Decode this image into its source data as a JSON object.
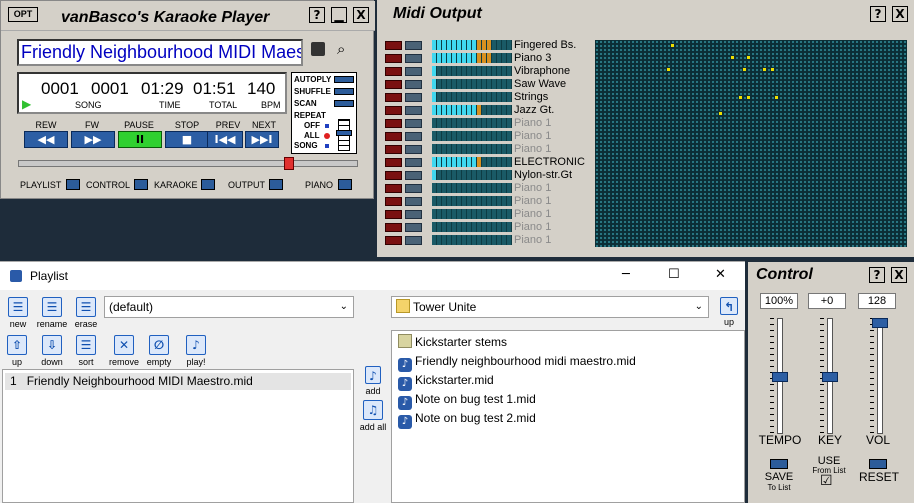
{
  "player": {
    "opt_label": "OPT",
    "title": "vanBasco's Karaoke Player",
    "help": "?",
    "minimize": "▁",
    "close": "X",
    "song_title": "Friendly Neighbourhood MIDI Maes",
    "lcd": {
      "song": "0001",
      "song_label": "SONG",
      "bar": "0001",
      "time": "01:29",
      "time_label": "TIME",
      "total": "01:51",
      "total_label": "TOTAL",
      "bpm": "140",
      "bpm_label": "BPM"
    },
    "options": {
      "autoply": "AUTOPLY",
      "shuffle": "SHUFFLE",
      "scan": "SCAN",
      "repeat": "REPEAT",
      "off": "OFF",
      "all": "ALL",
      "song": "SONG"
    },
    "transport": {
      "rew": "REW",
      "fw": "FW",
      "pause": "PAUSE",
      "stop": "STOP",
      "prev": "PREV",
      "next": "NEXT",
      "rew_glyph": "◀◀",
      "fw_glyph": "▶▶",
      "pause_glyph": "II",
      "stop_glyph": "■",
      "prev_glyph": "I◀◀",
      "next_glyph": "▶▶I"
    },
    "progress": 0.8,
    "bottom": {
      "playlist": "PLAYLIST",
      "control": "CONTROL",
      "karaoke": "KARAOKE",
      "output": "OUTPUT",
      "piano": "PIANO"
    }
  },
  "midi": {
    "title": "Midi Output",
    "help": "?",
    "close": "X",
    "channels": [
      {
        "name": "Fingered Bs.",
        "active": true,
        "level": 0.75
      },
      {
        "name": "Piano 3",
        "active": true,
        "level": 0.75
      },
      {
        "name": "Vibraphone",
        "active": true,
        "level": 0.05
      },
      {
        "name": "Saw Wave",
        "active": true,
        "level": 0.0
      },
      {
        "name": "Strings",
        "active": true,
        "level": 0.05
      },
      {
        "name": "Jazz Gt.",
        "active": true,
        "level": 0.65
      },
      {
        "name": "Piano 1",
        "active": false,
        "level": 0.0
      },
      {
        "name": "Piano 1",
        "active": false,
        "level": 0.0
      },
      {
        "name": "Piano 1",
        "active": false,
        "level": 0.0
      },
      {
        "name": "ELECTRONIC",
        "active": true,
        "level": 0.6
      },
      {
        "name": "Nylon-str.Gt",
        "active": true,
        "level": 0.0
      },
      {
        "name": "Piano 1",
        "active": false,
        "level": 0.0
      },
      {
        "name": "Piano 1",
        "active": false,
        "level": 0.0
      },
      {
        "name": "Piano 1",
        "active": false,
        "level": 0.0
      },
      {
        "name": "Piano 1",
        "active": false,
        "level": 0.0
      },
      {
        "name": "Piano 1",
        "active": false,
        "level": 0.0
      }
    ]
  },
  "playlist": {
    "title": "Playlist",
    "minimize": "─",
    "maximize": "☐",
    "close": "✕",
    "tools_top": {
      "new": "new",
      "rename": "rename",
      "erase": "erase"
    },
    "tools_bottom": {
      "up": "up",
      "down": "down",
      "sort": "sort",
      "remove": "remove",
      "empty": "empty",
      "play": "play!"
    },
    "preset": "(default)",
    "entries": [
      {
        "num": "1",
        "name": "Friendly Neighbourhood MIDI Maestro.mid"
      }
    ],
    "add": "add",
    "add_all": "add all",
    "folder": "Tower Unite",
    "folder_up": "up",
    "files": [
      {
        "type": "folder",
        "name": "Kickstarter stems"
      },
      {
        "type": "midi",
        "name": "Friendly neighbourhood midi maestro.mid"
      },
      {
        "type": "midi",
        "name": "Kickstarter.mid"
      },
      {
        "type": "midi",
        "name": "Note on bug test 1.mid"
      },
      {
        "type": "midi",
        "name": "Note on bug test 2.mid"
      }
    ]
  },
  "control": {
    "title": "Control",
    "help": "?",
    "close": "X",
    "tempo_value": "100%",
    "key_value": "+0",
    "vol_value": "128",
    "tempo_label": "TEMPO",
    "key_label": "KEY",
    "vol_label": "VOL",
    "tempo_level": 0.5,
    "key_level": 0.5,
    "vol_level": 1.0,
    "save": "SAVE",
    "save_sub": "To List",
    "use": "USE",
    "use_sub": "From List",
    "use_checked": "☑",
    "reset": "RESET"
  },
  "colors": {
    "lcd_blue": "#0000c0",
    "meter_cyan": "#40d8f0",
    "meter_orange": "#d89020",
    "note_yellow": "#f0e000",
    "button_blue": "#2c5ea4",
    "pause_green": "#30d030"
  }
}
